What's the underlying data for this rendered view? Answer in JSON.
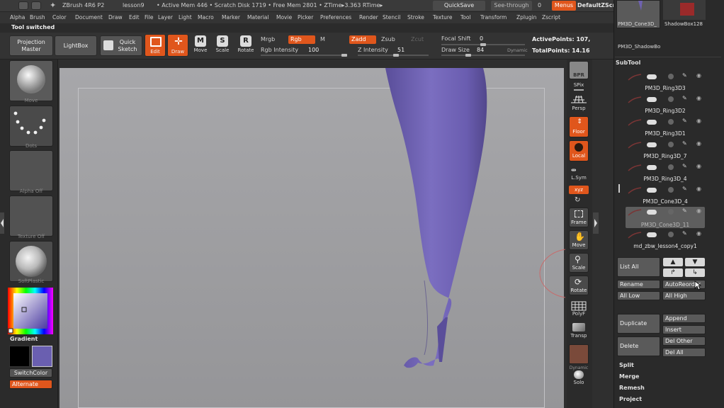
{
  "titlebar": {
    "app": "ZBrush 4R6 P2",
    "doc": "lesson9",
    "stats": "• Active Mem 446 • Scratch Disk 1719 • Free Mem 2801 • ZTime▸3.363 RTime▸",
    "quicksave": "QuickSave",
    "seethrough": "See-through",
    "seethrough_value": "0",
    "menus": "Menus",
    "defaultzscript": "DefaultZScript"
  },
  "menubar": [
    "Alpha",
    "Brush",
    "Color",
    "Document",
    "Draw",
    "Edit",
    "File",
    "Layer",
    "Light",
    "Macro",
    "Marker",
    "Material",
    "Movie",
    "Picker",
    "Preferences",
    "Render",
    "Stencil",
    "Stroke",
    "Texture",
    "Tool",
    "Transform",
    "Zplugin",
    "Zscript"
  ],
  "status": "Tool switched",
  "toolbar": {
    "projection_master": "Projection Master",
    "lightbox": "LightBox",
    "quick_sketch": "Quick Sketch",
    "edit": "Edit",
    "draw": "Draw",
    "move": "Move",
    "scale": "Scale",
    "rotate": "Rotate",
    "mrgb": "Mrgb",
    "rgb": "Rgb",
    "m": "M",
    "zadd": "Zadd",
    "zsub": "Zsub",
    "zcut": "Zcut",
    "rgb_intensity_label": "Rgb Intensity",
    "rgb_intensity": "100",
    "z_intensity_label": "Z Intensity",
    "z_intensity": "51",
    "focal_shift_label": "Focal Shift",
    "focal_shift": "0",
    "draw_size_label": "Draw Size",
    "draw_size": "84",
    "dynamic": "Dynamic",
    "active_points": "ActivePoints: 107,",
    "total_points": "TotalPoints: 14.16"
  },
  "leftshelf": {
    "move": "Move",
    "dots": "Dots",
    "alpha_off": "Alpha Off",
    "texture_off": "Texture Off",
    "softplastic": "SoftPlastic",
    "gradient": "Gradient",
    "switchcolor": "SwitchColor",
    "alternate": "Alternate"
  },
  "rightshelf": {
    "bpr": "BPR",
    "spix": "SPix",
    "persp": "Persp",
    "floor": "Floor",
    "local": "Local",
    "lsym": "L.Sym",
    "xyz": "xyz",
    "frame": "Frame",
    "move": "Move",
    "scale": "Scale",
    "rotate": "Rotate",
    "polyf": "PolyF",
    "transp": "Transp",
    "dynamic": "Dynamic",
    "solo": "Solo"
  },
  "rightpanel": {
    "top_thumbs": [
      "PM3D_Cone3D_",
      "ShadowBox128"
    ],
    "top_caption": "PM3D_ShadowBo",
    "subtool_title": "SubTool",
    "subtools": [
      {
        "name": "PM3D_Ring3D3",
        "selected": false
      },
      {
        "name": "PM3D_Ring3D2",
        "selected": false
      },
      {
        "name": "PM3D_Ring3D1",
        "selected": false
      },
      {
        "name": "PM3D_Ring3D_7",
        "selected": false
      },
      {
        "name": "PM3D_Ring3D_4",
        "selected": false
      },
      {
        "name": "PM3D_Cone3D_4",
        "selected": false
      },
      {
        "name": "PM3D_Cone3D_11",
        "selected": true
      },
      {
        "name": "md_zbw_lesson4_copy1",
        "selected": false
      }
    ],
    "list_all": "List All",
    "rename": "Rename",
    "autoreorder": "AutoReorder",
    "all_low": "All Low",
    "all_high": "All High",
    "duplicate": "Duplicate",
    "append": "Append",
    "insert": "Insert",
    "delete": "Delete",
    "del_other": "Del Other",
    "del_all": "Del All",
    "split": "Split",
    "merge": "Merge",
    "remesh": "Remesh",
    "project": "Project"
  },
  "colors": {
    "accent": "#e0561c",
    "model": "#6f62b0",
    "secondary_color": "#6a5fb0"
  }
}
